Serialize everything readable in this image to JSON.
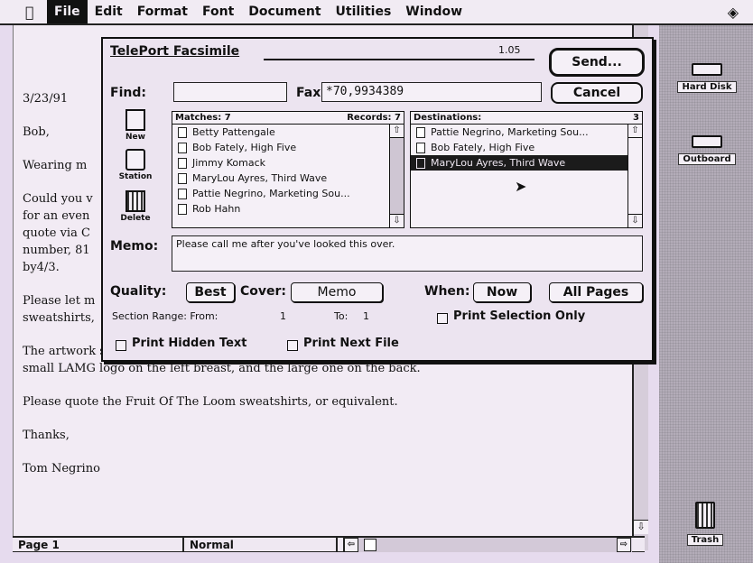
{
  "menubar": {
    "apple_icon": "apple-icon",
    "items": [
      "File",
      "Edit",
      "Format",
      "Font",
      "Document",
      "Utilities",
      "Window"
    ]
  },
  "desktop": {
    "hard_disk": "Hard Disk",
    "outboard": "Outboard",
    "trash": "Trash"
  },
  "document": {
    "paragraphs": [
      "3/23/91",
      "Bob,",
      "Wearing m",
      "Could you v\nfor an even\nquote via C\nnumber, 81\nby4/3.",
      "Please let m\nsweatshirts,",
      "The artwork stays the same as the previous T-shirt order; i.e., two sided, with the\nsmall LAMG logo on the left breast, and the large one on the back.",
      "Please quote the Fruit Of The Loom sweatshirts, or equivalent.",
      "Thanks,",
      "Tom Negrino"
    ]
  },
  "statusbar": {
    "page": "Page 1",
    "style": "Normal"
  },
  "dialog": {
    "title": "TelePort Facsimile",
    "version": "1.05",
    "send_label": "Send...",
    "cancel_label": "Cancel",
    "find_label": "Find:",
    "find_value": "",
    "fax_label": "Fax",
    "fax_value": "*70,9934389",
    "icons": {
      "new_label": "New",
      "station_label": "Station",
      "delete_label": "Delete"
    },
    "matches": {
      "header_left": "Matches: 7",
      "header_right": "Records: 7",
      "items": [
        "Betty Pattengale",
        "Bob Fately, High Five",
        "Jimmy Komack",
        "MaryLou Ayres, Third Wave",
        "Pattie Negrino, Marketing Sou...",
        "Rob Hahn"
      ]
    },
    "destinations": {
      "header_left": "Destinations:",
      "header_right": "3",
      "items": [
        "Pattie Negrino, Marketing Sou...",
        "Bob Fately, High Five",
        "MaryLou Ayres, Third Wave"
      ],
      "selected_index": 2
    },
    "memo_label": "Memo:",
    "memo_value": "Please call me after you've looked this over.",
    "quality_label": "Quality:",
    "quality_value": "Best",
    "cover_label": "Cover:",
    "cover_value": "Memo",
    "when_label": "When:",
    "when_value": "Now",
    "all_pages_label": "All Pages",
    "section_range_label": "Section Range: From:",
    "from_value": "1",
    "to_label": "To:",
    "to_value": "1",
    "print_selection_label": "Print Selection Only",
    "print_hidden_label": "Print Hidden Text",
    "print_next_label": "Print Next File"
  }
}
